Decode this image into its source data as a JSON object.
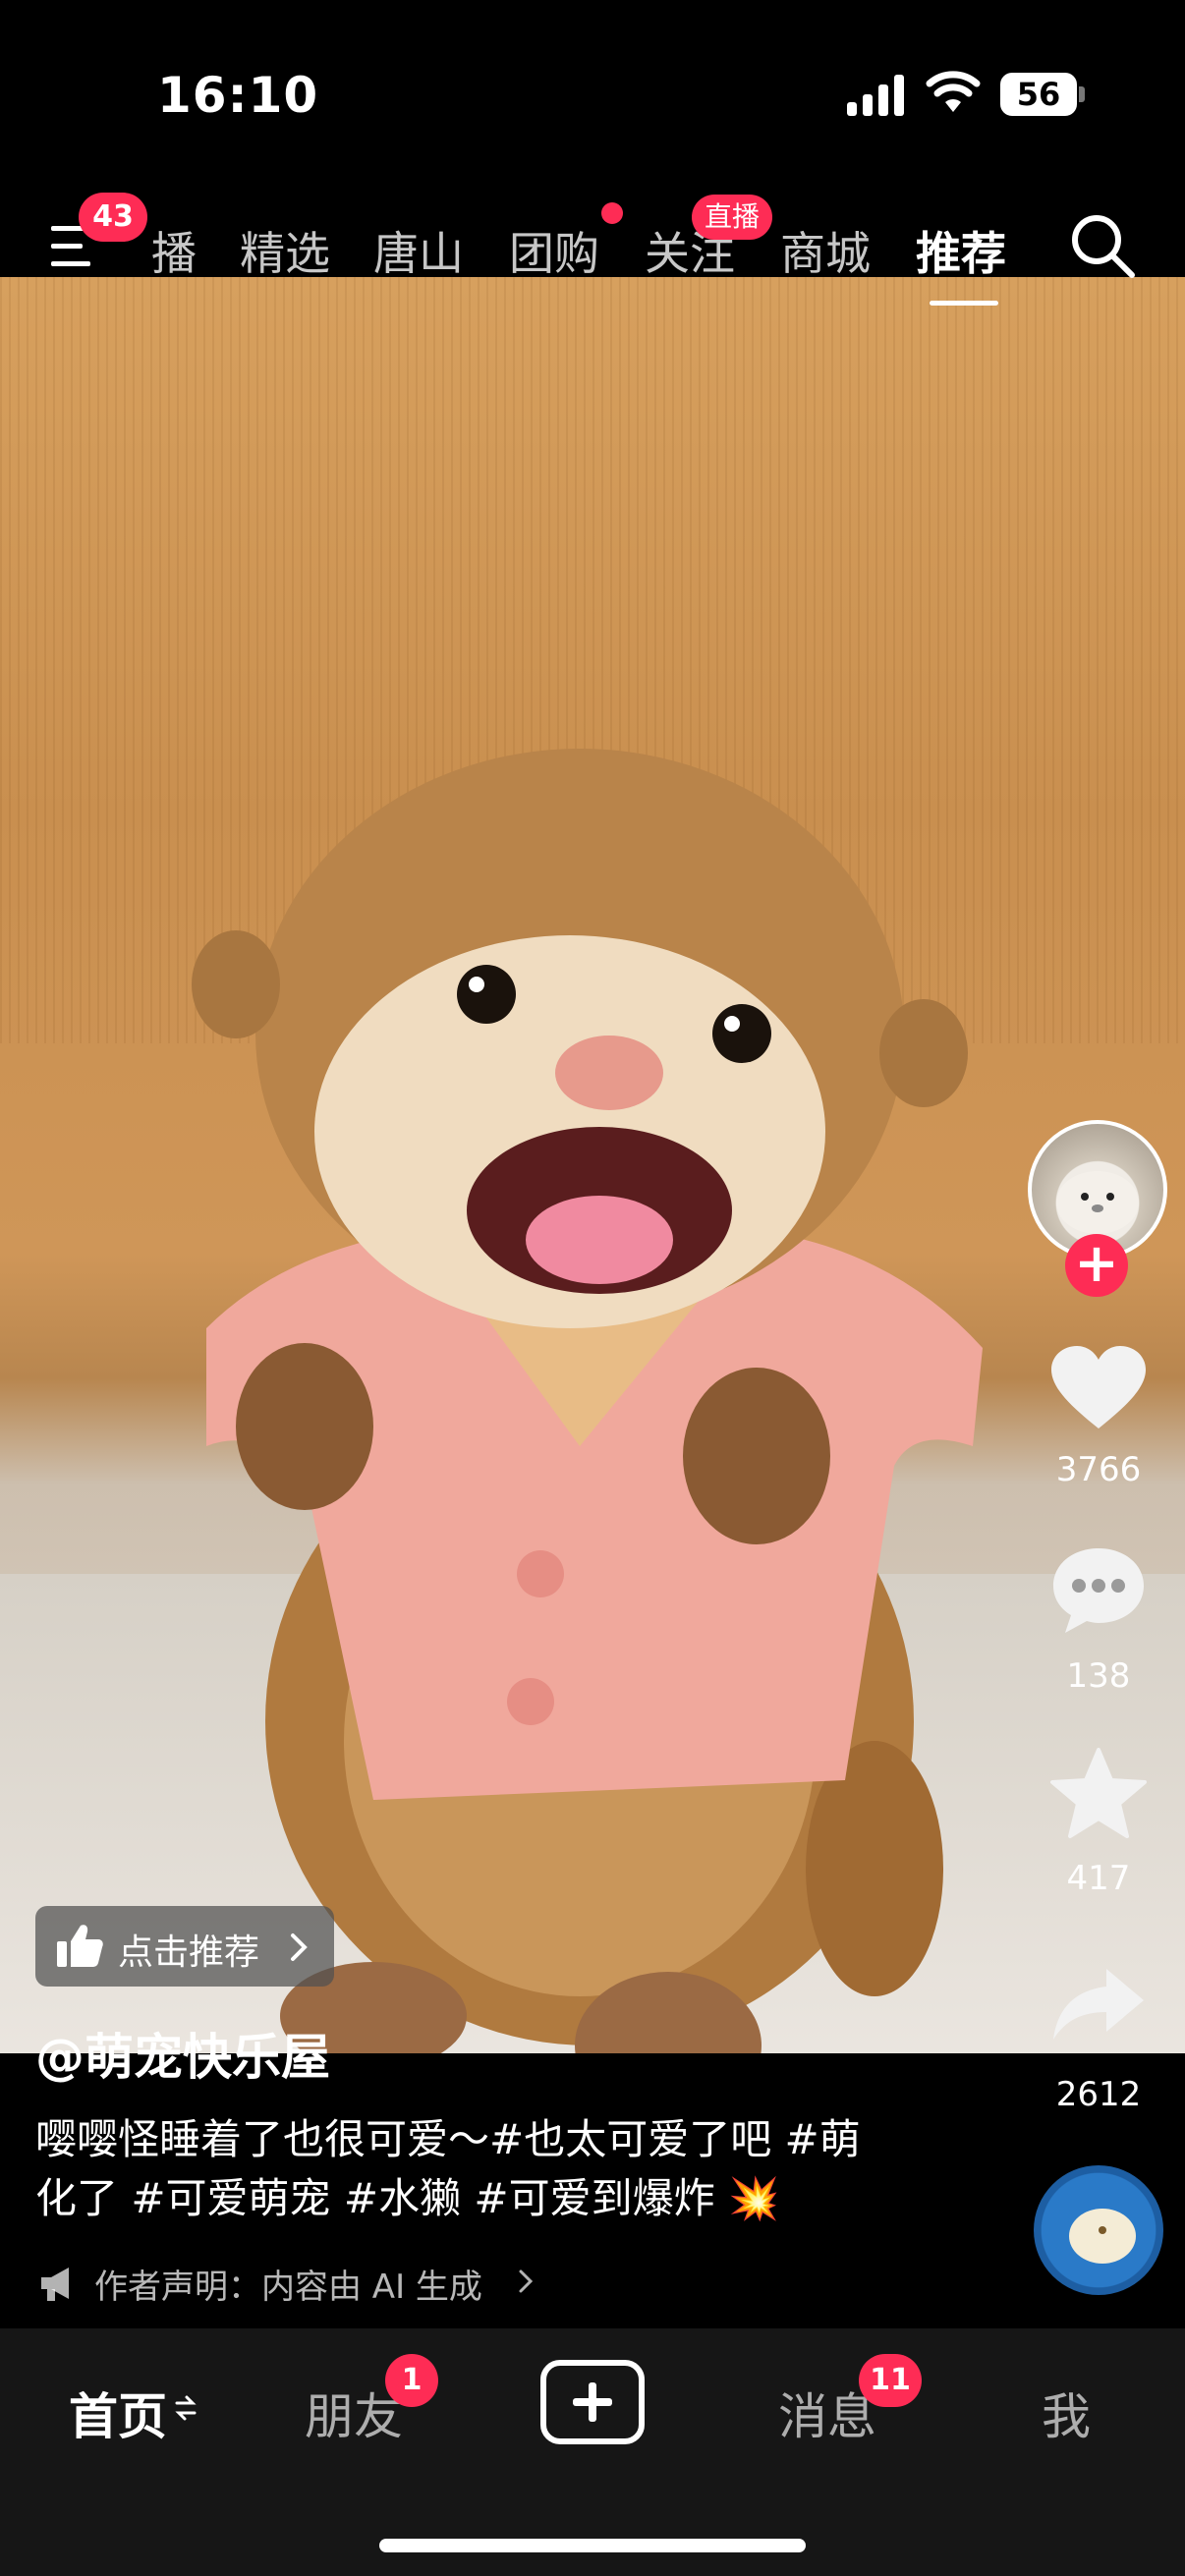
{
  "status_bar": {
    "time": "16:10",
    "battery": "56"
  },
  "top_nav": {
    "menu_badge": "43",
    "tabs": [
      {
        "label": "播"
      },
      {
        "label": "精选"
      },
      {
        "label": "唐山"
      },
      {
        "label": "团购"
      },
      {
        "label": "关注",
        "badge": "直播"
      },
      {
        "label": "商城"
      },
      {
        "label": "推荐",
        "active": true
      }
    ]
  },
  "video": {
    "recommend_label": "点击推荐",
    "author": "@萌宠快乐屋",
    "description_line1": "嘤嘤怪睡着了也很可爱～#也太可爱了吧 #萌",
    "description_line2": "化了 #可爱萌宠 #水獭 #可爱到爆炸 💥",
    "disclaimer": "作者声明：内容由 AI 生成"
  },
  "side_actions": {
    "likes": "3766",
    "comments": "138",
    "favorites": "417",
    "shares": "2612"
  },
  "bottom_nav": {
    "home": "首页",
    "friends": "朋友",
    "friends_badge": "1",
    "messages": "消息",
    "messages_badge": "11",
    "me": "我"
  },
  "colors": {
    "accent": "#fe2c55",
    "nav_bg": "#161616"
  }
}
